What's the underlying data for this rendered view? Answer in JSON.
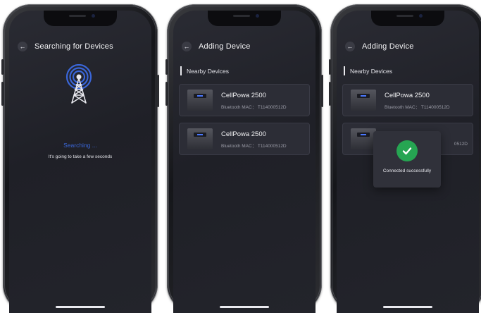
{
  "screens": [
    {
      "title": "Searching for Devices",
      "status": "Searching ...",
      "subtitle": "It's going to take a few seconds"
    },
    {
      "title": "Adding Device",
      "section_label": "Nearby Devices",
      "devices": [
        {
          "name": "CellPowa 2500",
          "mac": "Bluetooth MAC： T114000512D"
        },
        {
          "name": "CellPowa 2500",
          "mac": "Bluetooth MAC： T114000512D"
        }
      ]
    },
    {
      "title": "Adding Device",
      "section_label": "Nearby Devices",
      "devices": [
        {
          "name": "CellPowa 2500",
          "mac": "Bluetooth MAC： T114000512D"
        },
        {
          "name": "",
          "mac": "0512D"
        }
      ],
      "toast": "Connected successfully"
    }
  ],
  "icons": {
    "back": "back-arrow-icon",
    "tower": "signal-tower-icon",
    "check": "check-icon"
  },
  "colors": {
    "accent_blue": "#3a66d8",
    "success_green": "#26a552",
    "screen_bg": "#1f2027"
  }
}
